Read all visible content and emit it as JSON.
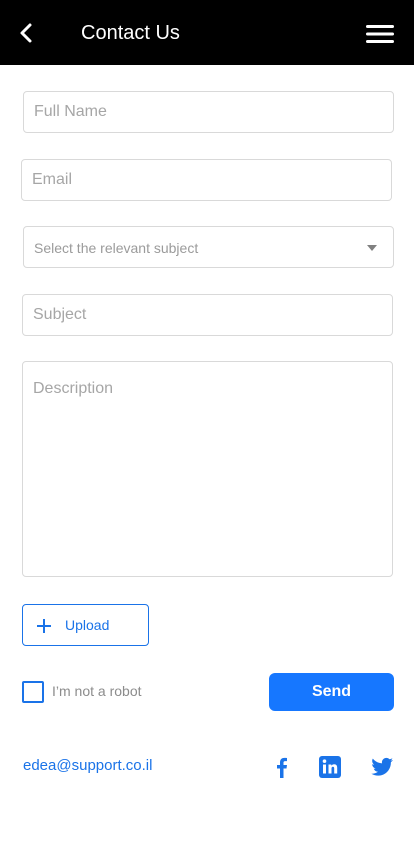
{
  "header": {
    "title": "Contact Us",
    "back_icon": "chevron-left-icon",
    "menu_icon": "hamburger-menu-icon",
    "background": "#000000"
  },
  "form": {
    "full_name": {
      "placeholder": "Full Name",
      "value": ""
    },
    "email": {
      "placeholder": "Email",
      "value": ""
    },
    "subject_select": {
      "selected": "Select the relevant subject",
      "icon": "caret-down-icon"
    },
    "subject": {
      "placeholder": "Subject",
      "value": ""
    },
    "description": {
      "placeholder": "Description",
      "value": ""
    }
  },
  "upload": {
    "label": "Upload",
    "icon": "plus-icon"
  },
  "captcha": {
    "label": "I’m not a robot",
    "checked": false
  },
  "send": {
    "label": "Send"
  },
  "footer": {
    "email": "edea@support.co.il",
    "social": [
      "facebook-icon",
      "linkedin-icon",
      "twitter-icon"
    ]
  },
  "colors": {
    "accent": "#1677ff",
    "link": "#1a73e8",
    "border": "#d9d9d9",
    "placeholder": "#a6a6a6"
  }
}
